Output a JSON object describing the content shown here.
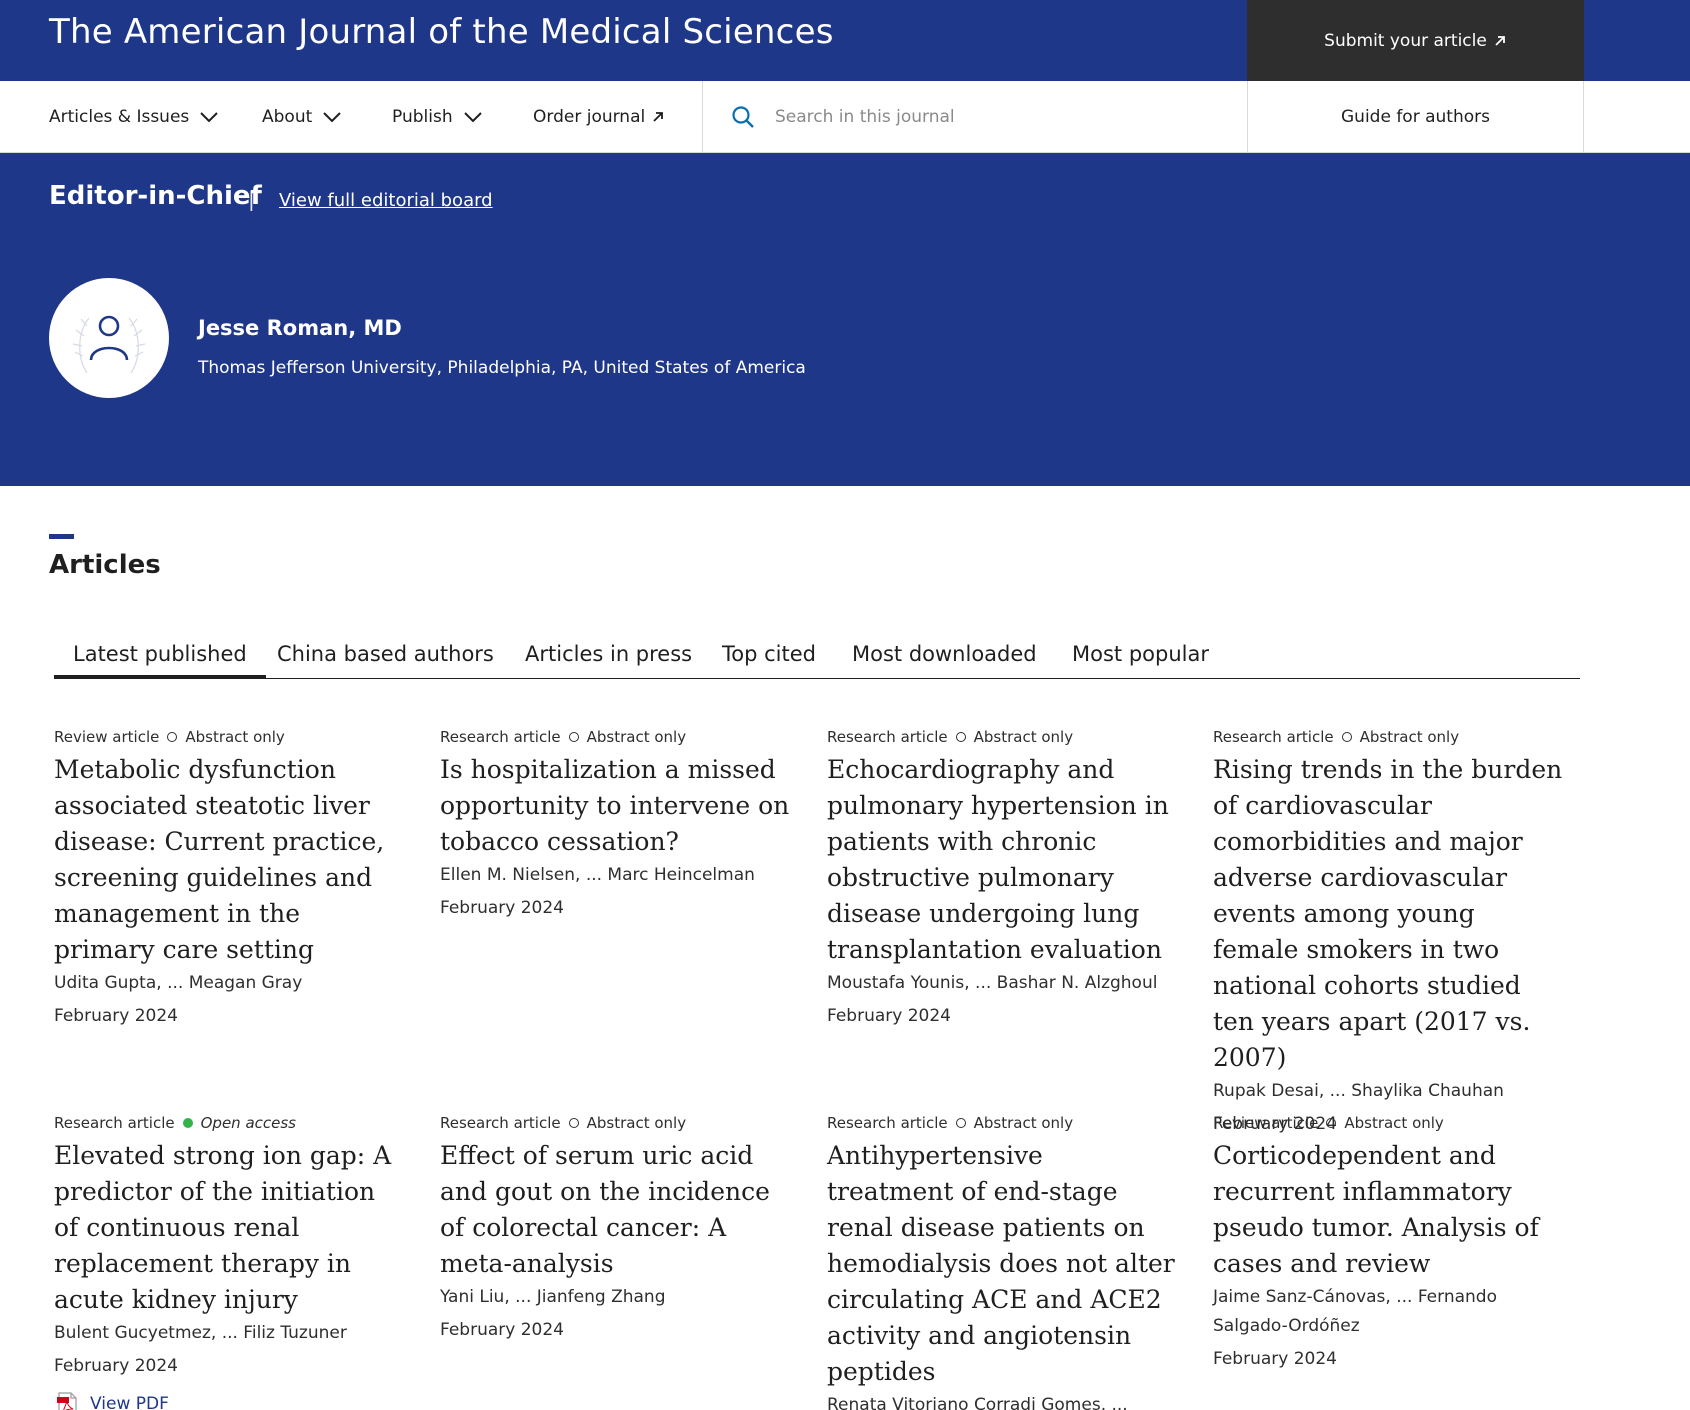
{
  "header": {
    "journal_title": "The American Journal of the Medical Sciences",
    "submit_label": "Submit your article"
  },
  "nav": {
    "articles_issues": "Articles & Issues",
    "about": "About",
    "publish": "Publish",
    "order_journal": "Order journal",
    "search_placeholder": "Search in this journal",
    "guide_for_authors": "Guide for authors"
  },
  "editor": {
    "heading": "Editor-in-Chief",
    "separator": "|",
    "board_link": "View full editorial board",
    "name": "Jesse Roman, MD",
    "affiliation": "Thomas Jefferson University, Philadelphia, PA, United States of America"
  },
  "articles": {
    "heading": "Articles",
    "tabs": [
      "Latest published",
      "China based authors",
      "Articles in press",
      "Top cited",
      "Most downloaded",
      "Most popular"
    ],
    "active_tab": "Latest published",
    "items": [
      {
        "type": "Review article",
        "access": "Abstract only",
        "title": "Metabolic dysfunction associated steatotic liver disease: Current practice, screening guidelines and management in the primary care setting",
        "authors": "Udita Gupta, ... Meagan Gray",
        "date": "February 2024"
      },
      {
        "type": "Research article",
        "access": "Abstract only",
        "title": "Is hospitalization a missed opportunity to intervene on tobacco cessation?",
        "authors": "Ellen M. Nielsen, ... Marc Heincelman",
        "date": "February 2024"
      },
      {
        "type": "Research article",
        "access": "Abstract only",
        "title": "Echocardiography and pulmonary hypertension in patients with chronic obstructive pulmonary disease undergoing lung transplantation evaluation",
        "authors": "Moustafa Younis, ... Bashar N. Alzghoul",
        "date": "February 2024"
      },
      {
        "type": "Research article",
        "access": "Abstract only",
        "title": "Rising trends in the burden of cardiovascular comorbidities and major adverse cardiovascular events among young female smokers in two national cohorts studied ten years apart (2017 vs. 2007)",
        "authors": "Rupak Desai, ... Shaylika Chauhan",
        "date": "February 2024"
      },
      {
        "type": "Research article",
        "access": "Open access",
        "title": "Elevated strong ion gap: A predictor of the initiation of continuous renal replacement therapy in acute kidney injury",
        "authors": "Bulent Gucyetmez, ... Filiz Tuzuner",
        "date": "February 2024",
        "pdf_label": "View PDF"
      },
      {
        "type": "Research article",
        "access": "Abstract only",
        "title": "Effect of serum uric acid and gout on the incidence of colorectal cancer: A meta-analysis",
        "authors": "Yani Liu, ... Jianfeng Zhang",
        "date": "February 2024"
      },
      {
        "type": "Research article",
        "access": "Abstract only",
        "title": "Antihypertensive treatment of end-stage renal disease patients on hemodialysis does not alter circulating ACE and ACE2 activity and angiotensin peptides",
        "authors": "Renata Vitoriano Corradi Gomes, ... Glaucia Rodrigues de Abreu",
        "date": ""
      },
      {
        "type": "Review article",
        "access": "Abstract only",
        "title": "Corticodependent and recurrent inflammatory pseudo tumor. Analysis of cases and review",
        "authors": "Jaime Sanz-Cánovas, ... Fernando Salgado-Ordóñez",
        "date": "February 2024"
      }
    ]
  },
  "colors": {
    "brand_blue": "#1f3789",
    "submit_bg": "#2e2e2e",
    "open_access_green": "#36b24a",
    "link_blue": "#1f3789"
  },
  "icons": {
    "chevron": "chevron-down-icon",
    "external": "external-link-icon",
    "search": "search-icon",
    "avatar": "user-icon",
    "pdf": "pdf-icon"
  }
}
